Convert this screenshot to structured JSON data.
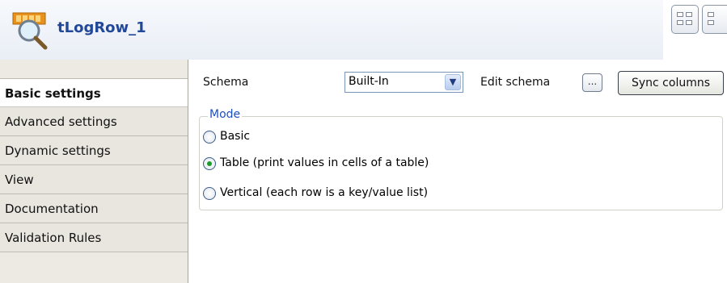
{
  "header": {
    "title": "tLogRow_1",
    "icon": "component-magnifier-icon"
  },
  "sidebar": {
    "tabs": [
      {
        "label": "Basic settings",
        "active": true
      },
      {
        "label": "Advanced settings",
        "active": false
      },
      {
        "label": "Dynamic settings",
        "active": false
      },
      {
        "label": "View",
        "active": false
      },
      {
        "label": "Documentation",
        "active": false
      },
      {
        "label": "Validation Rules",
        "active": false
      }
    ]
  },
  "schema": {
    "label": "Schema",
    "value": "Built-In",
    "edit_label": "Edit schema",
    "edit_button": "...",
    "sync_button": "Sync columns"
  },
  "mode": {
    "legend": "Mode",
    "options": [
      {
        "label": "Basic",
        "checked": false
      },
      {
        "label": "Table (print values in cells of a table)",
        "checked": true
      },
      {
        "label": "Vertical (each row is a key/value list)",
        "checked": false
      }
    ]
  },
  "colors": {
    "title": "#22489a",
    "legend": "#1d4fc3",
    "radio_checked": "#1b9c2a"
  }
}
